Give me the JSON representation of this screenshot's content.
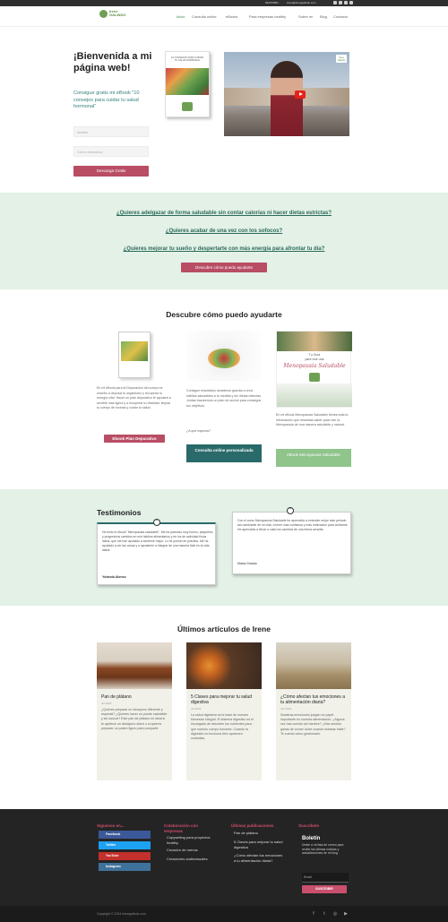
{
  "topbar": {
    "phone": "692370861",
    "email": "irene@irenegalindo.com"
  },
  "header": {
    "logo_text_1": "Irene",
    "logo_text_2": "GALINDO",
    "nav": [
      {
        "label": "Inicio",
        "active": true
      },
      {
        "label": "Consulta online",
        "active": false
      },
      {
        "label": "eBooks",
        "active": false
      },
      {
        "label": "Para empresas healthy",
        "active": false
      },
      {
        "label": "Sobre mí",
        "active": false
      },
      {
        "label": "Blog",
        "active": false
      },
      {
        "label": "Contacto",
        "active": false
      }
    ]
  },
  "hero": {
    "title": "¡Bienvenida a mi página web!",
    "subtitle": "Consigue gratis mi eBook \"10 consejos para cuidar tu salud hormonal\"",
    "name_placeholder": "Nombre",
    "email_placeholder": "Correo electrónico",
    "button": "Descarga Gratis",
    "book_title": "10 CONSEJOS PARA CUIDAR TU SALUD HORMONAL",
    "video_logo": "Irene Galindo"
  },
  "questions": {
    "q1": "¿Quieres adelgazar de forma saludable sin contar calorías ni hacer dietas estrictas?",
    "q2": "¿Quieres acabar de una vez con los sofocos?",
    "q3": "¿Quieres mejorar tu sueño y despertarte con más energía para afrontar tu día?",
    "button": "Descubre cómo puedo ayudarte"
  },
  "ayudarte": {
    "title": "Descubre cómo puedo ayudarte",
    "col1_text": "En mi eBook para la Depuración del cuerpo te enseño a depurar tu organismo y recuperar tu energía vital. Hacer un plan depurativo te ayudará a sentirte más ligera y a recuperar tu vitalidad, limpiar tu cuerpo de toxinas y cuidar tu salud.",
    "col1_button": "Ebook Plan Depurativo",
    "col2_text": "Consigue resultados duraderos gracias a unos hábitos saludables a tu medida y sin dietas estrictas. Juntas trazaremos un plan de acción para conseguir tus objetivos.",
    "col2_extra": "¿A qué esperas?",
    "col2_button": "Consulta online personalizada",
    "col3_text": "En mi eBook Menopausia Saludable tienes toda la información que necesitas saber para vivir la Menopausia de una manera saludable y natural.",
    "col3_button": "eBook Menopausia Saludable",
    "col3_img_top": "Tu Guía",
    "col3_img_mid": "para vivir una",
    "col3_img_script": "Menopausia Saludable"
  },
  "testimonios": {
    "title": "Testimonios",
    "t1_text": "He leído tu ebook \"Menopausia saludable\". Me ha parecido muy bueno: pequeños y progresivos cambios en mis hábitos alimentarios y en los de actividad física diaria, que me han ayudado a sentirme mejor. Lo he puesto en práctica. Me ha ayudado a ver las cosas y a ayudarme a integrar de una manera fácil en la vida diaria.",
    "t1_author": "Yolanda Alonso",
    "t2_text": "Con el curso Menopausia Saludable he aprendido a entender mejor este periodo tan cambiante de mi vida, a tener más confianza y más motivación para cuidarme. He aprendido a llevar a cabo los cambios de una forma sencilla.",
    "t2_author": "Marta Giraldo"
  },
  "articulos": {
    "title": "Últimos artículos de Irene",
    "items": [
      {
        "title": "Pan de plátano",
        "date": "Jul 2024",
        "text": "¿Quieres preparar un desayuno diferente y especial? ¿Quieres hacer un postre saludable y sin azúcar? Este pan de plátano es ideal si te apetece un desayuno dulce o si quieres preparar un postre ligero para compartir."
      },
      {
        "title": "5 Claves para mejorar tu salud digestiva",
        "date": "Jul 2024",
        "text": "La salud digestiva es la base de nuestro bienestar integral. El sistema digestivo es el encargado de absorber los nutrientes para que nuestro cuerpo funcione. Cuando la digestión no funciona bien aparecen molestias."
      },
      {
        "title": "¿Cómo afectan tus emociones a tu alimentación diaria?",
        "date": "Jun 2024",
        "text": "Nuestras emociones juegan un papel importante en nuestra alimentación. ¿Alguna vez has comido sin hambre? ¿Has sentido ganas de comer dulce cuando estabas triste? Te cuento cómo gestionarlo."
      }
    ]
  },
  "footer": {
    "col1_title": "Síguenos en...",
    "social": [
      {
        "label": "Facebook",
        "color": "#3b5998"
      },
      {
        "label": "Twitter",
        "color": "#1da1f2"
      },
      {
        "label": "YouTube",
        "color": "#c4302b"
      },
      {
        "label": "Instagram",
        "color": "#3f729b"
      }
    ],
    "col2_title": "Colaboración con empresas",
    "col2_links": [
      "Copywriting para proyectos healthy",
      "Creación de menús",
      "Creaciones audiovisuales"
    ],
    "col3_title": "Últimas publicaciones",
    "col3_links": [
      "Pan de plátano",
      "5 Claves para mejorar tu salud digestiva",
      "¿Cómo afectan tus emociones a tu alimentación diaria?"
    ],
    "col4_title": "Suscríbete",
    "boletin_title": "Boletín",
    "boletin_text": "Únete a mi lista de correo para recibir las últimas noticias y actualizaciones de mi blog.",
    "email_placeholder": "Email",
    "subscribe_button": "SUSCRIBIR",
    "copyright": "Copyright © 2024 irenegalindo.com"
  }
}
